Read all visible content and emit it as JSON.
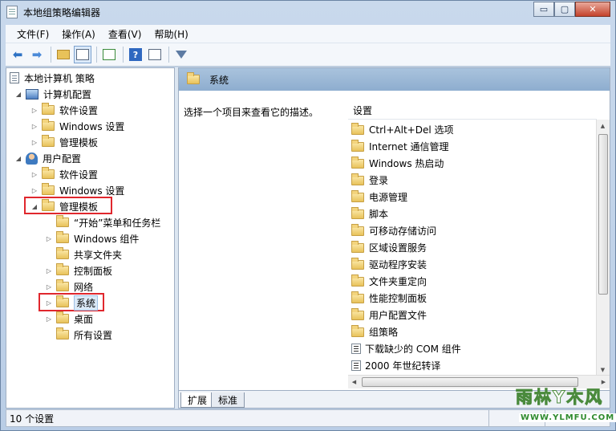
{
  "window": {
    "title": "本地组策略编辑器",
    "caption_min": "▭",
    "caption_max": "▢",
    "caption_close": "✕"
  },
  "menu": [
    "文件(F)",
    "操作(A)",
    "查看(V)",
    "帮助(H)"
  ],
  "toolbar": {
    "icons": [
      "back-arrow-icon",
      "forward-arrow-icon",
      "up-folder-icon",
      "show-hide-tree-icon",
      "export-list-icon",
      "help-icon",
      "properties-view-icon",
      "filter-icon"
    ]
  },
  "tree": {
    "root": "本地计算机 策略",
    "computer_config": "计算机配置",
    "cc_software": "软件设置",
    "cc_windows": "Windows 设置",
    "cc_admin": "管理模板",
    "user_config": "用户配置",
    "uc_software": "软件设置",
    "uc_windows": "Windows 设置",
    "uc_admin": "管理模板",
    "start_menu": "“开始”菜单和任务栏",
    "win_components": "Windows 组件",
    "shared_folders": "共享文件夹",
    "control_panel": "控制面板",
    "network": "网络",
    "system": "系统",
    "desktop": "桌面",
    "all_settings": "所有设置"
  },
  "right": {
    "header_title": "系统",
    "description": "选择一个项目来查看它的描述。",
    "column_header": "设置",
    "items": [
      {
        "label": "Ctrl+Alt+Del 选项",
        "kind": "folder"
      },
      {
        "label": "Internet 通信管理",
        "kind": "folder"
      },
      {
        "label": "Windows 热启动",
        "kind": "folder"
      },
      {
        "label": "登录",
        "kind": "folder"
      },
      {
        "label": "电源管理",
        "kind": "folder"
      },
      {
        "label": "脚本",
        "kind": "folder"
      },
      {
        "label": "可移动存储访问",
        "kind": "folder"
      },
      {
        "label": "区域设置服务",
        "kind": "folder"
      },
      {
        "label": "驱动程序安装",
        "kind": "folder"
      },
      {
        "label": "文件夹重定向",
        "kind": "folder"
      },
      {
        "label": "性能控制面板",
        "kind": "folder"
      },
      {
        "label": "用户配置文件",
        "kind": "folder"
      },
      {
        "label": "组策略",
        "kind": "folder"
      },
      {
        "label": "下载缺少的 COM 组件",
        "kind": "setting"
      },
      {
        "label": "2000 年世纪转译",
        "kind": "setting"
      }
    ]
  },
  "tabs": {
    "extended": "扩展",
    "standard": "标准"
  },
  "status": {
    "text": "10 个设置"
  },
  "watermark": {
    "brand": "雨林Y木风",
    "url": "WWW.YLMFU.COM"
  },
  "colors": {
    "highlight_red": "#e0272d",
    "header_blue": "#8eadcf"
  }
}
